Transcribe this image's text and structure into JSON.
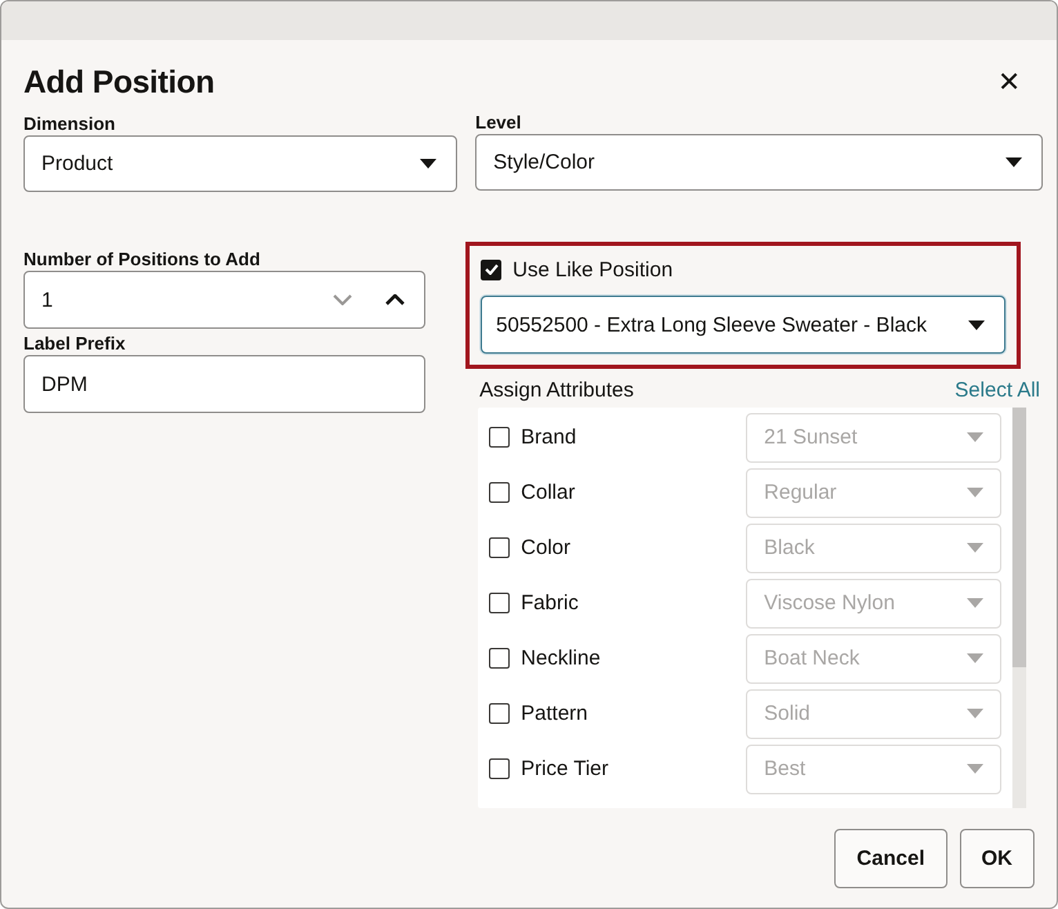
{
  "dialog": {
    "title": "Add Position",
    "close_label": "✕"
  },
  "dimension": {
    "label": "Dimension",
    "value": "Product"
  },
  "level": {
    "label": "Level",
    "value": "Style/Color"
  },
  "number_of_positions": {
    "label": "Number of Positions to Add",
    "value": "1",
    "decrement_disabled": true,
    "increment_disabled": false
  },
  "label_prefix": {
    "label": "Label Prefix",
    "value": "DPM"
  },
  "use_like_position": {
    "label": "Use Like Position",
    "checked": true,
    "highlighted": true,
    "value": "50552500 - Extra Long Sleeve Sweater - Black"
  },
  "assign_attributes": {
    "label": "Assign Attributes",
    "select_all": "Select All",
    "items": [
      {
        "name": "Brand",
        "checked": false,
        "value": "21 Sunset",
        "disabled": true
      },
      {
        "name": "Collar",
        "checked": false,
        "value": "Regular",
        "disabled": true
      },
      {
        "name": "Color",
        "checked": false,
        "value": "Black",
        "disabled": true
      },
      {
        "name": "Fabric",
        "checked": false,
        "value": "Viscose Nylon",
        "disabled": true
      },
      {
        "name": "Neckline",
        "checked": false,
        "value": "Boat Neck",
        "disabled": true
      },
      {
        "name": "Pattern",
        "checked": false,
        "value": "Solid",
        "disabled": true
      },
      {
        "name": "Price Tier",
        "checked": false,
        "value": "Best",
        "disabled": true
      }
    ]
  },
  "buttons": [
    {
      "label": "Cancel"
    },
    {
      "label": "OK"
    }
  ]
}
